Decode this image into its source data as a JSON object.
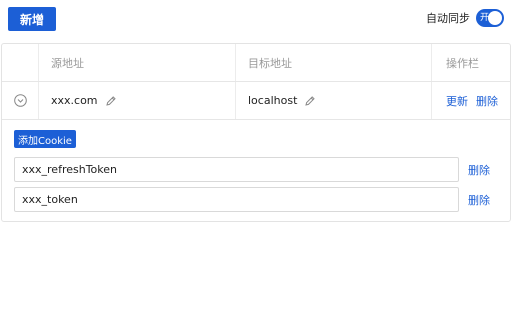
{
  "toolbar": {
    "add_label": "新增"
  },
  "sync": {
    "label": "自动同步",
    "toggle_text": "开",
    "enabled": true
  },
  "table": {
    "columns": [
      "",
      "源地址",
      "目标地址",
      "操作栏"
    ],
    "rows": [
      {
        "source": "xxx.com",
        "target": "localhost",
        "actions": {
          "update": "更新",
          "delete": "删除"
        }
      }
    ]
  },
  "expanded": {
    "add_cookie_label": "添加Cookie",
    "cookies": [
      {
        "value": "xxx_refreshToken",
        "delete_label": "删除"
      },
      {
        "value": "xxx_token",
        "delete_label": "删除"
      }
    ]
  },
  "colors": {
    "accent": "#1c5fd6",
    "border": "#e3e3e3",
    "muted": "#999999"
  }
}
